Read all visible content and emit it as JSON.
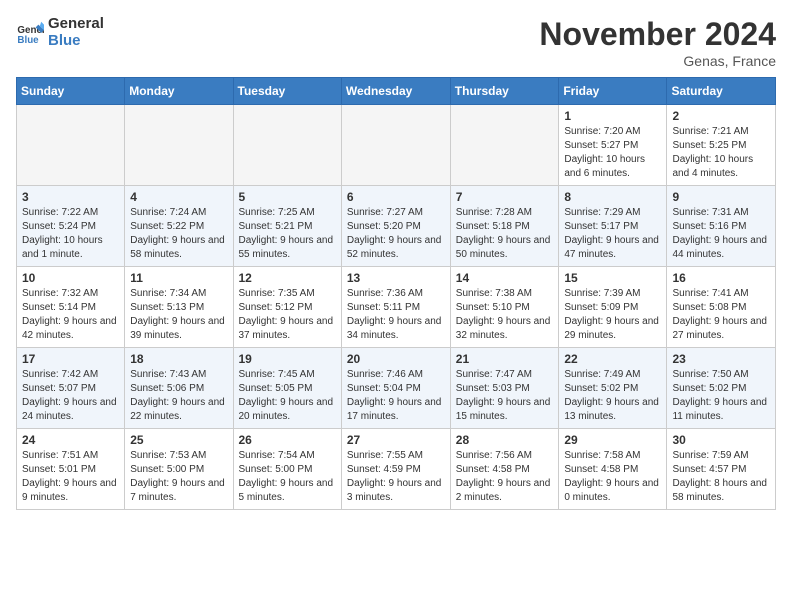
{
  "logo": {
    "text1": "General",
    "text2": "Blue"
  },
  "header": {
    "month": "November 2024",
    "location": "Genas, France"
  },
  "weekdays": [
    "Sunday",
    "Monday",
    "Tuesday",
    "Wednesday",
    "Thursday",
    "Friday",
    "Saturday"
  ],
  "weeks": [
    [
      {
        "day": "",
        "info": ""
      },
      {
        "day": "",
        "info": ""
      },
      {
        "day": "",
        "info": ""
      },
      {
        "day": "",
        "info": ""
      },
      {
        "day": "",
        "info": ""
      },
      {
        "day": "1",
        "info": "Sunrise: 7:20 AM\nSunset: 5:27 PM\nDaylight: 10 hours\nand 6 minutes."
      },
      {
        "day": "2",
        "info": "Sunrise: 7:21 AM\nSunset: 5:25 PM\nDaylight: 10 hours\nand 4 minutes."
      }
    ],
    [
      {
        "day": "3",
        "info": "Sunrise: 7:22 AM\nSunset: 5:24 PM\nDaylight: 10 hours\nand 1 minute."
      },
      {
        "day": "4",
        "info": "Sunrise: 7:24 AM\nSunset: 5:22 PM\nDaylight: 9 hours\nand 58 minutes."
      },
      {
        "day": "5",
        "info": "Sunrise: 7:25 AM\nSunset: 5:21 PM\nDaylight: 9 hours\nand 55 minutes."
      },
      {
        "day": "6",
        "info": "Sunrise: 7:27 AM\nSunset: 5:20 PM\nDaylight: 9 hours\nand 52 minutes."
      },
      {
        "day": "7",
        "info": "Sunrise: 7:28 AM\nSunset: 5:18 PM\nDaylight: 9 hours\nand 50 minutes."
      },
      {
        "day": "8",
        "info": "Sunrise: 7:29 AM\nSunset: 5:17 PM\nDaylight: 9 hours\nand 47 minutes."
      },
      {
        "day": "9",
        "info": "Sunrise: 7:31 AM\nSunset: 5:16 PM\nDaylight: 9 hours\nand 44 minutes."
      }
    ],
    [
      {
        "day": "10",
        "info": "Sunrise: 7:32 AM\nSunset: 5:14 PM\nDaylight: 9 hours\nand 42 minutes."
      },
      {
        "day": "11",
        "info": "Sunrise: 7:34 AM\nSunset: 5:13 PM\nDaylight: 9 hours\nand 39 minutes."
      },
      {
        "day": "12",
        "info": "Sunrise: 7:35 AM\nSunset: 5:12 PM\nDaylight: 9 hours\nand 37 minutes."
      },
      {
        "day": "13",
        "info": "Sunrise: 7:36 AM\nSunset: 5:11 PM\nDaylight: 9 hours\nand 34 minutes."
      },
      {
        "day": "14",
        "info": "Sunrise: 7:38 AM\nSunset: 5:10 PM\nDaylight: 9 hours\nand 32 minutes."
      },
      {
        "day": "15",
        "info": "Sunrise: 7:39 AM\nSunset: 5:09 PM\nDaylight: 9 hours\nand 29 minutes."
      },
      {
        "day": "16",
        "info": "Sunrise: 7:41 AM\nSunset: 5:08 PM\nDaylight: 9 hours\nand 27 minutes."
      }
    ],
    [
      {
        "day": "17",
        "info": "Sunrise: 7:42 AM\nSunset: 5:07 PM\nDaylight: 9 hours\nand 24 minutes."
      },
      {
        "day": "18",
        "info": "Sunrise: 7:43 AM\nSunset: 5:06 PM\nDaylight: 9 hours\nand 22 minutes."
      },
      {
        "day": "19",
        "info": "Sunrise: 7:45 AM\nSunset: 5:05 PM\nDaylight: 9 hours\nand 20 minutes."
      },
      {
        "day": "20",
        "info": "Sunrise: 7:46 AM\nSunset: 5:04 PM\nDaylight: 9 hours\nand 17 minutes."
      },
      {
        "day": "21",
        "info": "Sunrise: 7:47 AM\nSunset: 5:03 PM\nDaylight: 9 hours\nand 15 minutes."
      },
      {
        "day": "22",
        "info": "Sunrise: 7:49 AM\nSunset: 5:02 PM\nDaylight: 9 hours\nand 13 minutes."
      },
      {
        "day": "23",
        "info": "Sunrise: 7:50 AM\nSunset: 5:02 PM\nDaylight: 9 hours\nand 11 minutes."
      }
    ],
    [
      {
        "day": "24",
        "info": "Sunrise: 7:51 AM\nSunset: 5:01 PM\nDaylight: 9 hours\nand 9 minutes."
      },
      {
        "day": "25",
        "info": "Sunrise: 7:53 AM\nSunset: 5:00 PM\nDaylight: 9 hours\nand 7 minutes."
      },
      {
        "day": "26",
        "info": "Sunrise: 7:54 AM\nSunset: 5:00 PM\nDaylight: 9 hours\nand 5 minutes."
      },
      {
        "day": "27",
        "info": "Sunrise: 7:55 AM\nSunset: 4:59 PM\nDaylight: 9 hours\nand 3 minutes."
      },
      {
        "day": "28",
        "info": "Sunrise: 7:56 AM\nSunset: 4:58 PM\nDaylight: 9 hours\nand 2 minutes."
      },
      {
        "day": "29",
        "info": "Sunrise: 7:58 AM\nSunset: 4:58 PM\nDaylight: 9 hours\nand 0 minutes."
      },
      {
        "day": "30",
        "info": "Sunrise: 7:59 AM\nSunset: 4:57 PM\nDaylight: 8 hours\nand 58 minutes."
      }
    ]
  ]
}
